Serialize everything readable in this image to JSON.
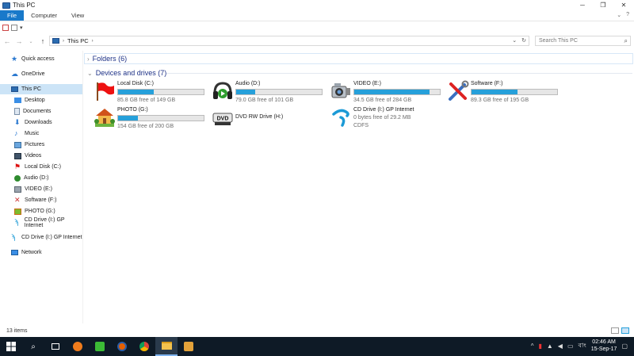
{
  "window": {
    "title": "This PC"
  },
  "ribbon": {
    "tabs": [
      "File",
      "Computer",
      "View"
    ]
  },
  "address": {
    "segment": "This PC"
  },
  "search": {
    "placeholder": "Search This PC"
  },
  "nav": {
    "items": [
      {
        "label": "Quick access",
        "icon": "star-icon"
      },
      {
        "label": "OneDrive",
        "icon": "cloud-icon"
      },
      {
        "label": "This PC",
        "icon": "computer-icon"
      },
      {
        "label": "Desktop",
        "icon": "desktop-icon"
      },
      {
        "label": "Documents",
        "icon": "documents-icon"
      },
      {
        "label": "Downloads",
        "icon": "download-icon"
      },
      {
        "label": "Music",
        "icon": "music-icon"
      },
      {
        "label": "Pictures",
        "icon": "pictures-icon"
      },
      {
        "label": "Videos",
        "icon": "videos-icon"
      },
      {
        "label": "Local Disk (C:)",
        "icon": "flag-icon"
      },
      {
        "label": "Audio (D:)",
        "icon": "headphones-icon"
      },
      {
        "label": "VIDEO (E:)",
        "icon": "camera-icon"
      },
      {
        "label": "Software (F:)",
        "icon": "tools-icon"
      },
      {
        "label": "PHOTO (G:)",
        "icon": "house-icon"
      },
      {
        "label": "CD Drive (I:) GP Internet",
        "icon": "gp-icon"
      },
      {
        "label": "CD Drive (I:) GP Internet",
        "icon": "gp-icon"
      },
      {
        "label": "Network",
        "icon": "network-icon"
      }
    ]
  },
  "groups": {
    "folders": "Folders (6)",
    "devices": "Devices and drives (7)"
  },
  "drives": [
    {
      "name": "Local Disk (C:)",
      "free": "85.8 GB free of 149 GB",
      "used_fraction": 0.42,
      "icon": "flag-icon"
    },
    {
      "name": "Audio (D:)",
      "free": "79.0 GB free of 101 GB",
      "used_fraction": 0.22,
      "icon": "headphones-icon"
    },
    {
      "name": "VIDEO (E:)",
      "free": "34.5 GB free of 284 GB",
      "used_fraction": 0.88,
      "icon": "camera-icon"
    },
    {
      "name": "Software (F:)",
      "free": "89.3 GB free of 195 GB",
      "used_fraction": 0.54,
      "icon": "tools-icon"
    },
    {
      "name": "PHOTO (G:)",
      "free": "154 GB free of 200 GB",
      "used_fraction": 0.23,
      "icon": "house-icon"
    },
    {
      "name": "DVD RW Drive (H:)",
      "icon": "dvd-icon"
    },
    {
      "name": "CD Drive (I:) GP Internet",
      "free": "0 bytes free of 29.2 MB",
      "filesystem": "CDFS",
      "icon": "gp-icon"
    }
  ],
  "status": {
    "items": "13 items"
  },
  "taskbar": {
    "time": "02:46 AM",
    "date": "15-Sep-17",
    "lang": "বাং"
  },
  "colors": {
    "accent": "#1979ca",
    "bar_fill": "#26a0da",
    "group_header": "#1e3287",
    "selected": "#cce4f7"
  }
}
